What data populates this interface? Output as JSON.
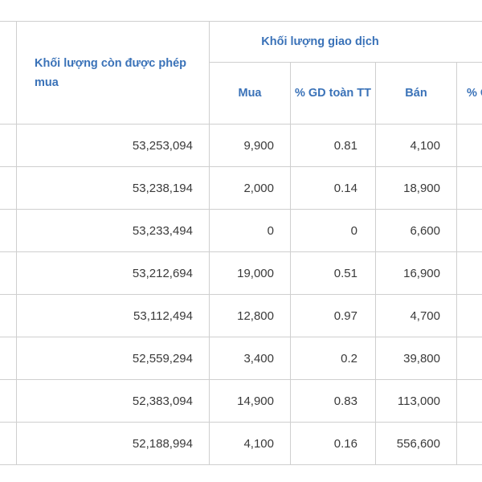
{
  "table": {
    "header": {
      "remaining_label": "Khối lượng còn được phép mua",
      "group_label": "Khối lượng giao dịch",
      "cols": {
        "buy": "Mua",
        "pct_buy": "% GD toàn TT",
        "sell": "Bán",
        "pct_sell": "% G"
      }
    },
    "rows": [
      {
        "remaining": "53,253,094",
        "buy": "9,900",
        "pct": "0.81",
        "sell": "4,100"
      },
      {
        "remaining": "53,238,194",
        "buy": "2,000",
        "pct": "0.14",
        "sell": "18,900"
      },
      {
        "remaining": "53,233,494",
        "buy": "0",
        "pct": "0",
        "sell": "6,600"
      },
      {
        "remaining": "53,212,694",
        "buy": "19,000",
        "pct": "0.51",
        "sell": "16,900"
      },
      {
        "remaining": "53,112,494",
        "buy": "12,800",
        "pct": "0.97",
        "sell": "4,700"
      },
      {
        "remaining": "52,559,294",
        "buy": "3,400",
        "pct": "0.2",
        "sell": "39,800"
      },
      {
        "remaining": "52,383,094",
        "buy": "14,900",
        "pct": "0.83",
        "sell": "113,000"
      },
      {
        "remaining": "52,188,994",
        "buy": "4,100",
        "pct": "0.16",
        "sell": "556,600"
      }
    ]
  }
}
